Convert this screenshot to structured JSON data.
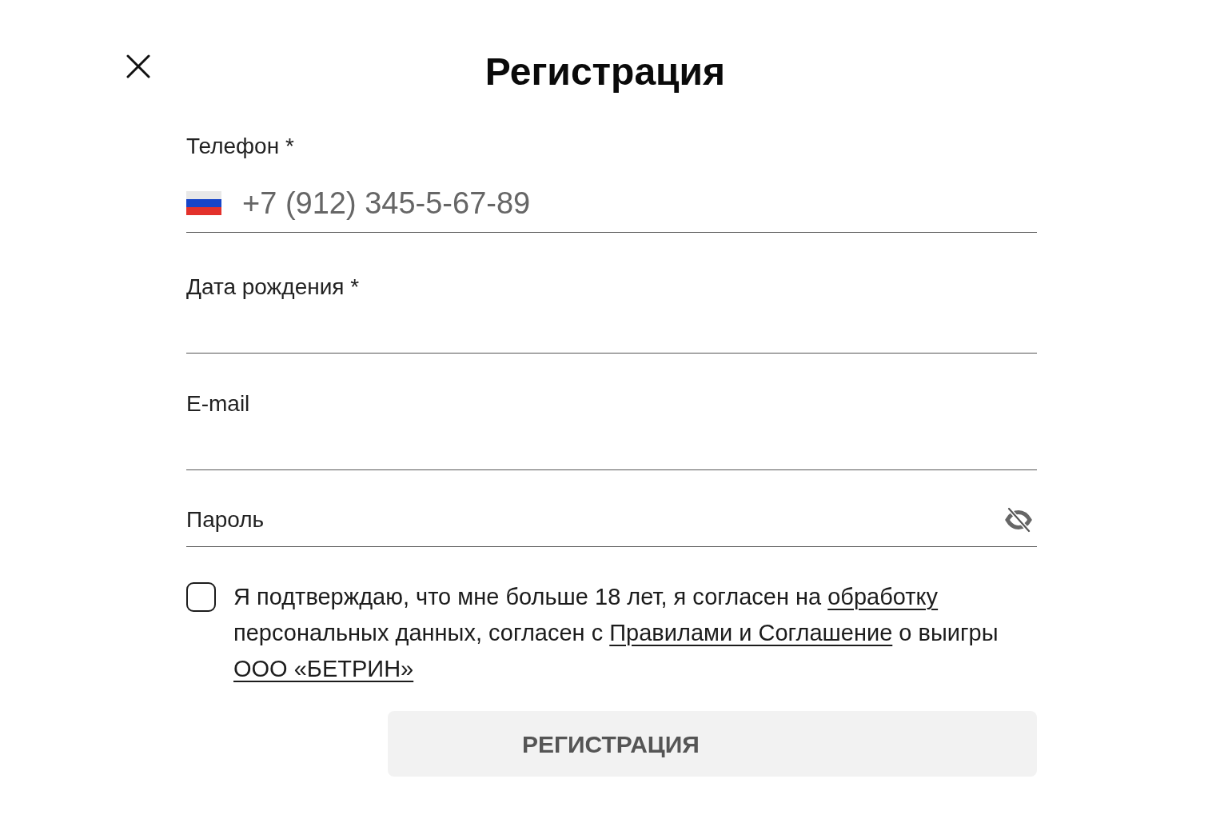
{
  "header": {
    "title": "Регистрация"
  },
  "fields": [
    {
      "kind": "phone",
      "label": "Телефон *",
      "placeholder": "+7 (912) 345-5-67-89"
    },
    {
      "kind": "text",
      "label": "Дата рождения *"
    },
    {
      "kind": "text",
      "label": "E-mail"
    },
    {
      "kind": "password",
      "placeholder": "Пароль"
    }
  ],
  "consent": {
    "checked": false,
    "lines": [
      [
        {
          "kind": "text",
          "text": "Я подтверждаю, что мне больше 18 лет, я согласен на "
        },
        {
          "kind": "link",
          "text": "обработку"
        }
      ],
      [
        {
          "kind": "text",
          "text": "персональных данных, согласен с "
        },
        {
          "kind": "link",
          "text": "Правилами и Соглашение"
        },
        {
          "kind": "text",
          "text": " о выигры"
        }
      ],
      [
        {
          "kind": "link",
          "text": "ООО «БЕТРИН»"
        }
      ]
    ]
  },
  "submit": {
    "label": "РЕГИСТРАЦИЯ",
    "disabled": true
  }
}
